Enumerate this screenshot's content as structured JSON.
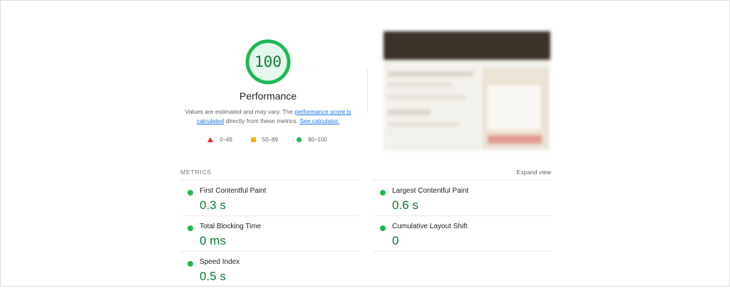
{
  "score": {
    "value": "100",
    "fraction": 1.0,
    "title": "Performance",
    "ring_color": "#1db954",
    "fill_color": "#e6f7ec"
  },
  "description": {
    "text_1": "Values are estimated and may vary. The ",
    "link_1": "performance score is calculated",
    "text_2": " directly from these metrics. ",
    "link_2": "See calculator."
  },
  "legend": [
    {
      "icon": "triangle-fail-icon",
      "label": "0–49",
      "color": "#d93025"
    },
    {
      "icon": "square-average-icon",
      "label": "50–89",
      "color": "#f4b400"
    },
    {
      "icon": "circle-pass-icon",
      "label": "90–100",
      "color": "#1db954"
    }
  ],
  "metrics": {
    "header": "METRICS",
    "expand_label": "Expand view",
    "items": [
      {
        "name": "First Contentful Paint",
        "value": "0.3 s",
        "status": "pass"
      },
      {
        "name": "Largest Contentful Paint",
        "value": "0.6 s",
        "status": "pass"
      },
      {
        "name": "Total Blocking Time",
        "value": "0 ms",
        "status": "pass"
      },
      {
        "name": "Cumulative Layout Shift",
        "value": "0",
        "status": "pass"
      },
      {
        "name": "Speed Index",
        "value": "0.5 s",
        "status": "pass"
      }
    ]
  }
}
